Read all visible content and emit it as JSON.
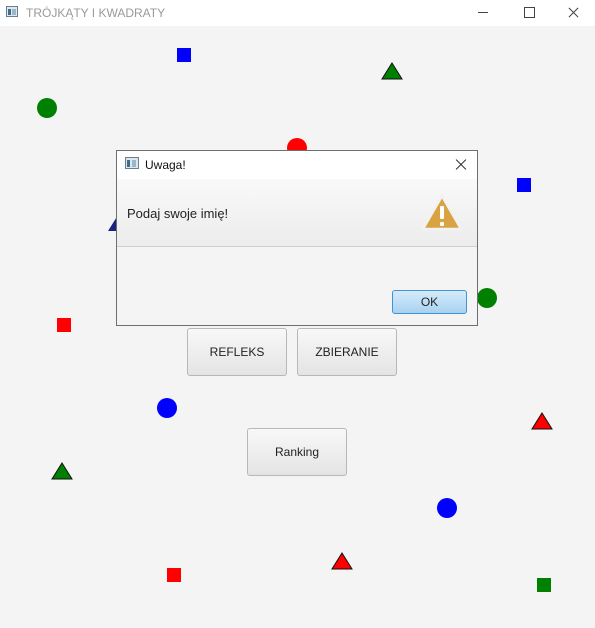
{
  "window": {
    "title": "TRÓJKĄTY I KWADRATY"
  },
  "buttons": {
    "refleks": "REFLEKS",
    "zbieranie": "ZBIERANIE",
    "ranking": "Ranking"
  },
  "dialog": {
    "title": "Uwaga!",
    "message": "Podaj swoje imię!",
    "ok": "OK"
  },
  "colors": {
    "red": "#ff0000",
    "green": "#008000",
    "blue": "#0000ff",
    "navy": "#1a237e"
  }
}
